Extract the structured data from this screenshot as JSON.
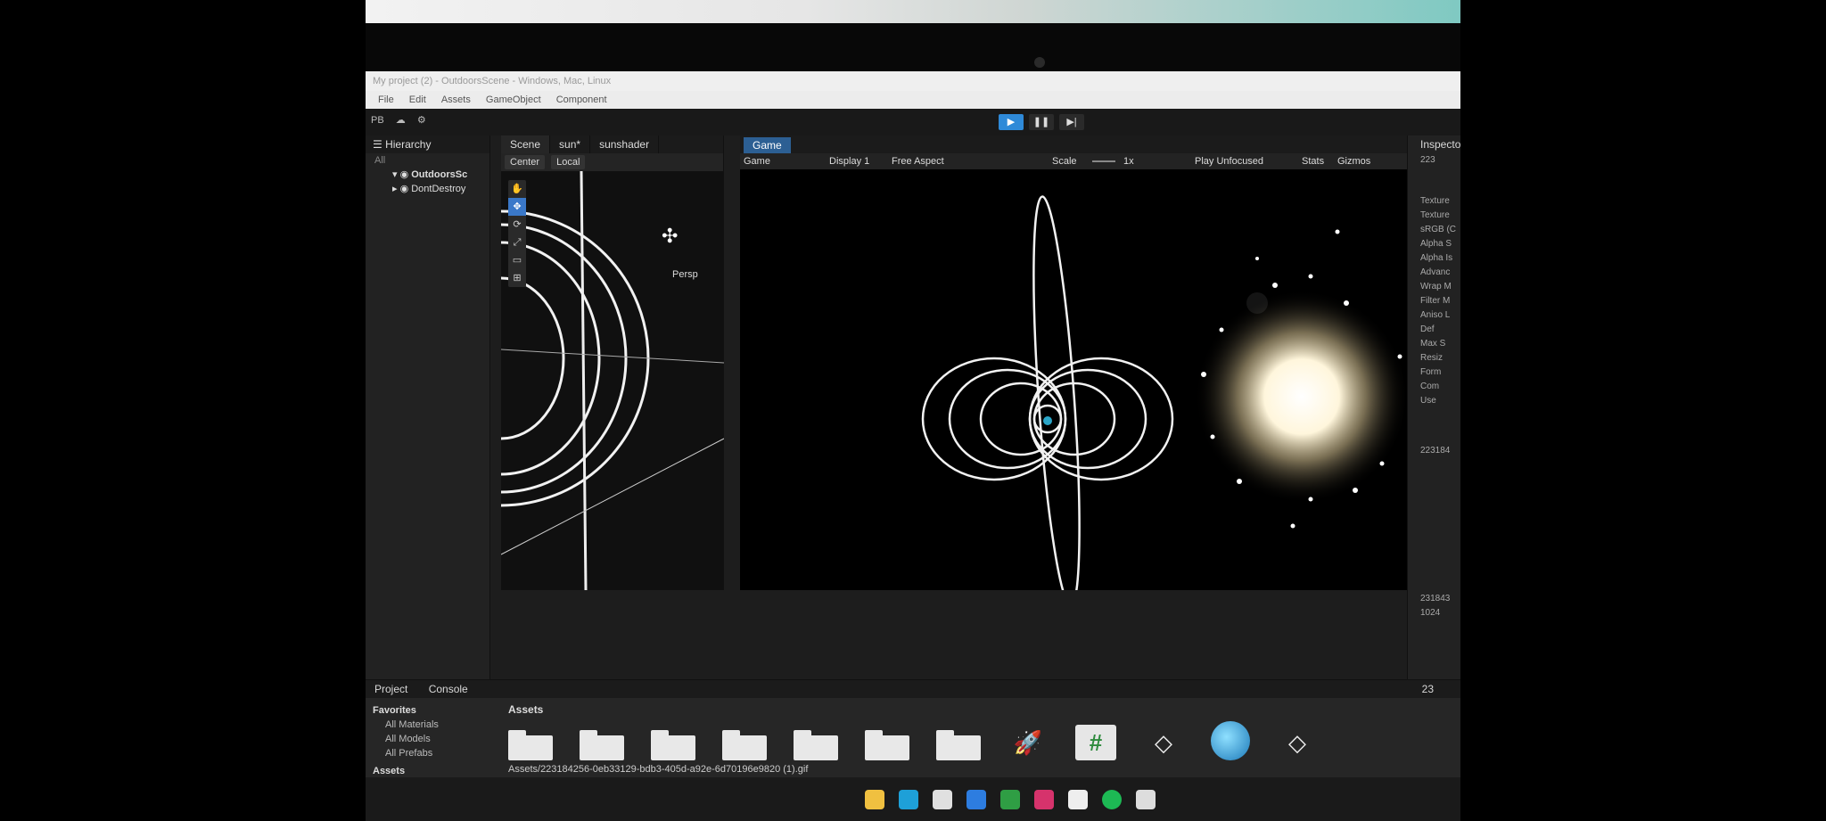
{
  "titlebar": {
    "text": "My project (2) - OutdoorsScene - Windows, Mac, Linux"
  },
  "menu": {
    "items": [
      "File",
      "Edit",
      "Assets",
      "GameObject",
      "Component"
    ]
  },
  "toolbar": {
    "account": "PB",
    "play_icon": "play-icon",
    "pause_icon": "pause-icon",
    "step_icon": "step-icon",
    "accent": "#2f8ad8"
  },
  "hierarchy": {
    "title": "Hierarchy",
    "search_placeholder": "All",
    "items": [
      "OutdoorsSc",
      "DontDestroy"
    ]
  },
  "scene": {
    "tabs": [
      "Scene",
      "sun*",
      "sunshader"
    ],
    "tools": {
      "pivot": "Center",
      "space": "Local"
    },
    "persp_label": "Persp",
    "tool_icons": [
      "hand-icon",
      "move-icon",
      "rotate-icon",
      "scale-icon",
      "rect-icon",
      "transform-icon"
    ]
  },
  "game": {
    "tab": "Game",
    "mode": "Game",
    "display": "Display 1",
    "aspect": "Free Aspect",
    "scale_label": "Scale",
    "scale_value": "1x",
    "play_focus": "Play Unfocused",
    "stats": "Stats",
    "gizmos": "Gizmos"
  },
  "inspector": {
    "title": "Inspector",
    "number": "223",
    "rows": [
      "Texture",
      "Texture",
      "sRGB (C",
      "Alpha S",
      "Alpha Is",
      "Advanc",
      "Wrap M",
      "Filter M",
      "Aniso L",
      "Def",
      "Max S",
      "Resiz",
      "Form",
      "Com",
      "Use"
    ],
    "footer": "223184",
    "size_line1": "231843",
    "size_line2": "1024"
  },
  "bottom": {
    "tabs": [
      "Project",
      "Console"
    ],
    "favorites_title": "Favorites",
    "favorites": [
      "All Materials",
      "All Models",
      "All Prefabs"
    ],
    "assets_section": "Assets",
    "assets_title": "Assets",
    "path": "Assets/223184256-0eb33129-bdb3-405d-a92e-6d70196e9820 (1).gif",
    "counter": "23"
  }
}
